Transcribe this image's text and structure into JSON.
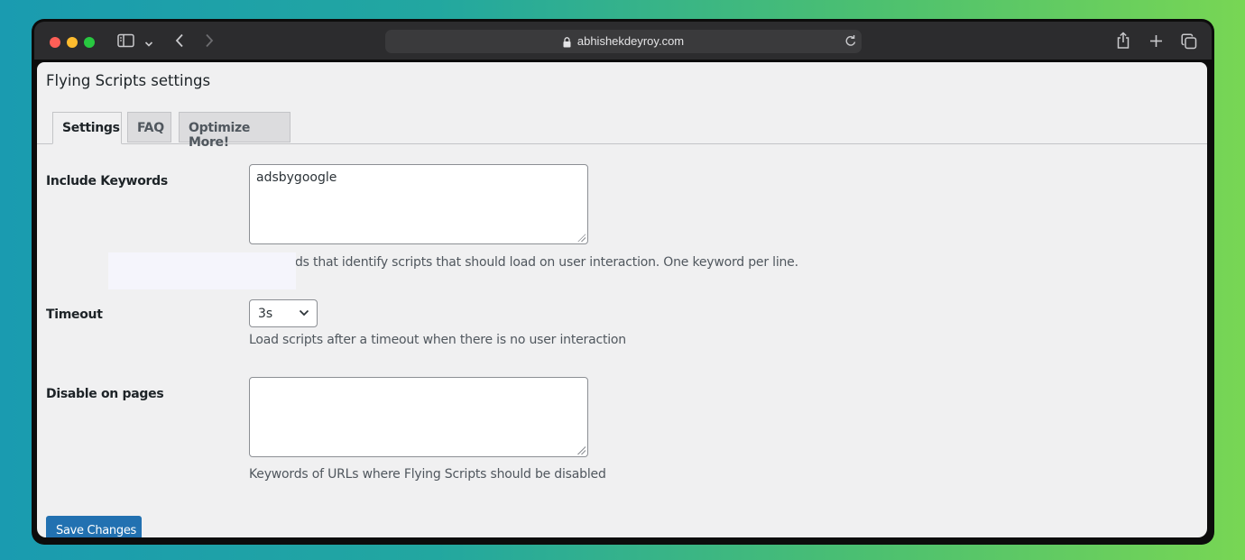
{
  "browser": {
    "url": "abhishekdeyroy.com",
    "icons": [
      "sidebar-icon",
      "chevron-down-icon",
      "back-icon",
      "forward-icon",
      "lock-icon",
      "reload-icon",
      "share-icon",
      "new-tab-icon",
      "tabs-overview-icon"
    ]
  },
  "page": {
    "title": "Flying Scripts settings",
    "tabs": [
      {
        "label": "Settings",
        "active": true
      },
      {
        "label": "FAQ",
        "active": false
      },
      {
        "label": "Optimize More!",
        "active": false
      }
    ]
  },
  "form": {
    "include_keywords": {
      "label": "Include Keywords",
      "value": "adsbygoogle",
      "description": "ds that identify scripts that should load on user interaction. One keyword per line."
    },
    "timeout": {
      "label": "Timeout",
      "value": "3s",
      "description": "Load scripts after a timeout when there is no user interaction"
    },
    "disable_on_pages": {
      "label": "Disable on pages",
      "value": "",
      "description": "Keywords of URLs where Flying Scripts should be disabled"
    },
    "save_label": "Save Changes"
  }
}
